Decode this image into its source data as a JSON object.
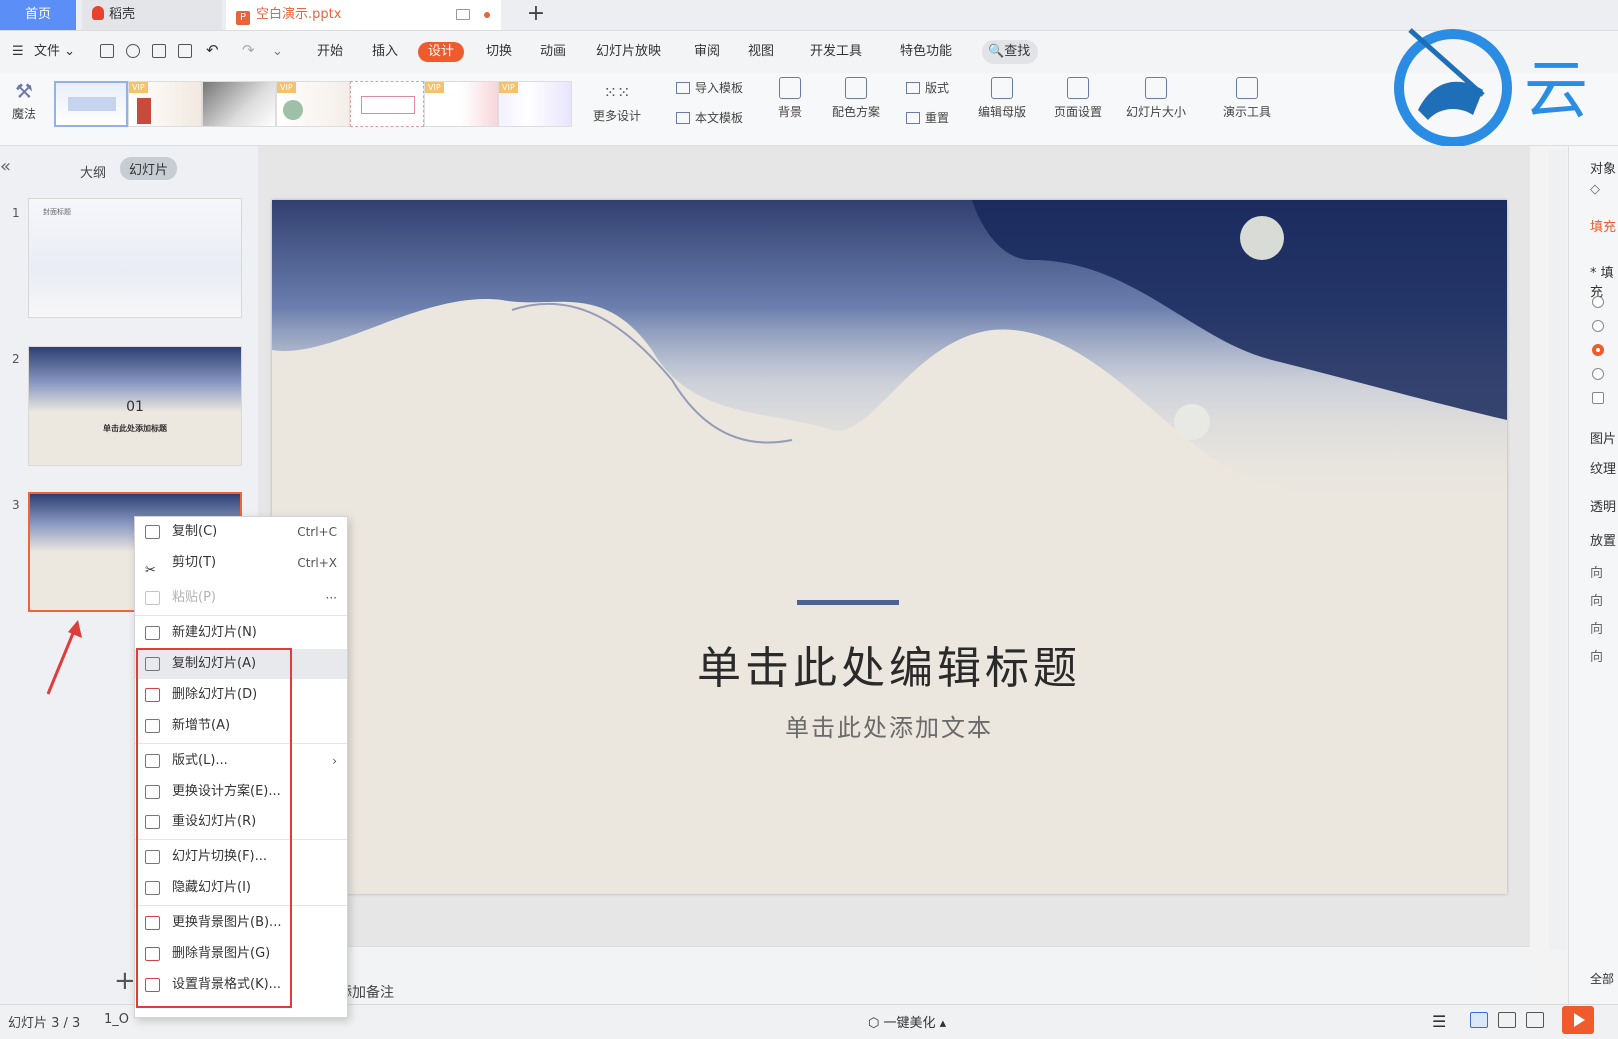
{
  "tabs": {
    "home": "首页",
    "daoke": "稻壳",
    "document": "空白演示.pptx",
    "new_tab": "+"
  },
  "menubar": {
    "file": "文件",
    "items": [
      "开始",
      "插入",
      "设计",
      "切换",
      "动画",
      "幻灯片放映",
      "审阅",
      "视图",
      "开发工具",
      "特色功能"
    ],
    "active": "设计",
    "search": "查找"
  },
  "ribbon": {
    "magic": "魔法",
    "vip_badge": "VIP",
    "more_design": "更多设计",
    "import_template": "导入模板",
    "this_template": "本文模板",
    "background": "背景",
    "color_scheme": "配色方案",
    "layout": "版式",
    "reset": "重置",
    "edit_master": "编辑母版",
    "page_setup": "页面设置",
    "slide_size": "幻灯片大小",
    "present_tools": "演示工具"
  },
  "left_panel": {
    "collapse": "«",
    "outline_tab": "大纲",
    "slides_tab": "幻灯片",
    "thumbnails": [
      {
        "number": "1",
        "caption": "封面标题"
      },
      {
        "number": "2",
        "big": "01",
        "caption": "单击此处添加标题"
      },
      {
        "number": "3"
      }
    ],
    "add_slide": "+"
  },
  "slide": {
    "title": "单击此处编辑标题",
    "subtitle": "单击此处添加文本"
  },
  "notes": {
    "placeholder": "添加备注"
  },
  "context_menu": {
    "items": [
      {
        "label": "复制(C)",
        "shortcut": "Ctrl+C"
      },
      {
        "label": "剪切(T)",
        "shortcut": "Ctrl+X"
      },
      {
        "label": "粘贴(P)",
        "shortcut": "···",
        "disabled": true
      },
      {
        "label": "新建幻灯片(N)"
      },
      {
        "label": "复制幻灯片(A)",
        "hover": true
      },
      {
        "label": "删除幻灯片(D)"
      },
      {
        "label": "新增节(A)"
      },
      {
        "label": "版式(L)...",
        "submenu": "›"
      },
      {
        "label": "更换设计方案(E)..."
      },
      {
        "label": "重设幻灯片(R)"
      },
      {
        "label": "幻灯片切换(F)..."
      },
      {
        "label": "隐藏幻灯片(I)"
      },
      {
        "label": "更换背景图片(B)..."
      },
      {
        "label": "删除背景图片(G)"
      },
      {
        "label": "设置背景格式(K)..."
      }
    ]
  },
  "statusbar": {
    "slide_count": "幻灯片 3 / 3",
    "theme": "1_O",
    "beautify": "一键美化"
  },
  "right_panel": {
    "title": "对象",
    "fill_tab": "填充",
    "fill_section": "* 填充",
    "image": "图片",
    "texture": "纹理",
    "transparency": "透明",
    "placement": "放置",
    "direction": "向",
    "full": "全部"
  },
  "logo": {
    "text": "云"
  },
  "colors": {
    "accent": "#f05b2d",
    "selection": "#f0643c",
    "highlight_box": "#e03c3c",
    "home_tab": "#5b8ef7"
  }
}
